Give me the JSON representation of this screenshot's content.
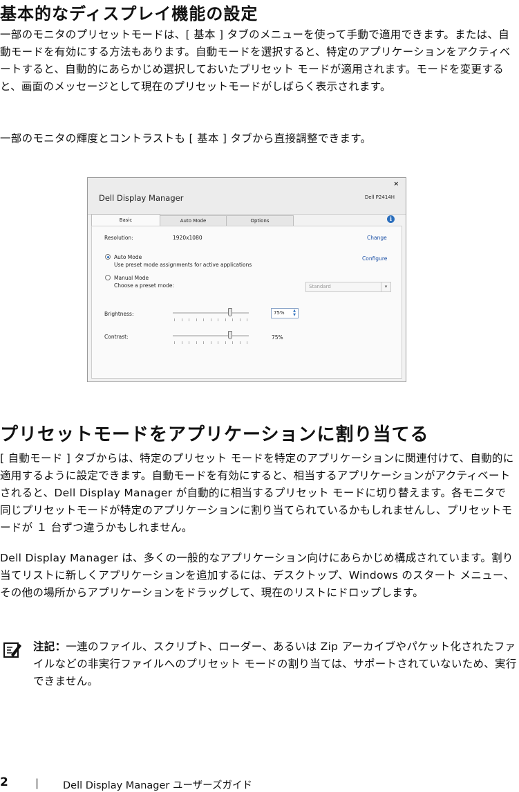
{
  "heading1": "基本的なディスプレイ機能の設定",
  "para1": "一部のモニタのプリセットモードは、[ 基本 ] タブのメニューを使って手動で適用できます。または、自動モードを有効にする方法もあります。自動モードを選択すると、特定のアプリケーションをアクティベートすると、自動的にあらかじめ選択しておいたプリセット モードが適用されます。モードを変更すると、画面のメッセージとして現在のプリセットモードがしばらく表示されます。",
  "para2": "一部のモニタの輝度とコントラストも [ 基本 ] タブから直接調整できます。",
  "screenshot": {
    "app_title": "Dell Display Manager",
    "model": "Dell P2414H",
    "close_glyph": "×",
    "tabs": [
      "Basic",
      "Auto Mode",
      "Options"
    ],
    "info_glyph": "i",
    "resolution_label": "Resolution:",
    "resolution_value": "1920x1080",
    "change_link": "Change",
    "auto_mode_label": "Auto Mode",
    "auto_mode_desc": "Use preset mode assignments for active applications",
    "configure_link": "Configure",
    "manual_mode_label": "Manual Mode",
    "manual_mode_desc": "Choose a preset mode:",
    "preset_value": "Standard",
    "brightness_label": "Brightness:",
    "brightness_value": "75%",
    "brightness_level": 0.75,
    "contrast_label": "Contrast:",
    "contrast_value": "75%",
    "contrast_level": 0.75
  },
  "heading2": "プリセットモードをアプリケーションに割り当てる",
  "para3": "[ 自動モード ] タブからは、特定のプリセット モードを特定のアプリケーションに関連付けて、自動的に適用するように設定できます。自動モードを有効にすると、相当するアプリケーションがアクティベートされると、Dell Display Manager が自動的に相当するプリセット モードに切り替えます。各モニタで同じプリセットモードが特定のアプリケーションに割り当てられているかもしれませんし、プリセットモードが １ 台ずつ違うかもしれません。",
  "para4": "Dell Display Manager は、多くの一般的なアプリケーション向けにあらかじめ構成されています。割り当てリストに新しくアプリケーションを追加するには、デスクトップ、Windows のスタート メニュー、その他の場所からアプリケーションをドラッグして、現在のリストにドロップします。",
  "note_label": "注記：",
  "note_text": "一連のファイル、スクリプト、ローダー、あるいは Zip アーカイブやパケット化されたファイルなどの非実行ファイルへのプリセット モードの割り当ては、サポートされていないため、実行できません。",
  "footer": {
    "page_number": "2",
    "separator": "|",
    "title": "Dell Display Manager ユーザーズガイド"
  }
}
